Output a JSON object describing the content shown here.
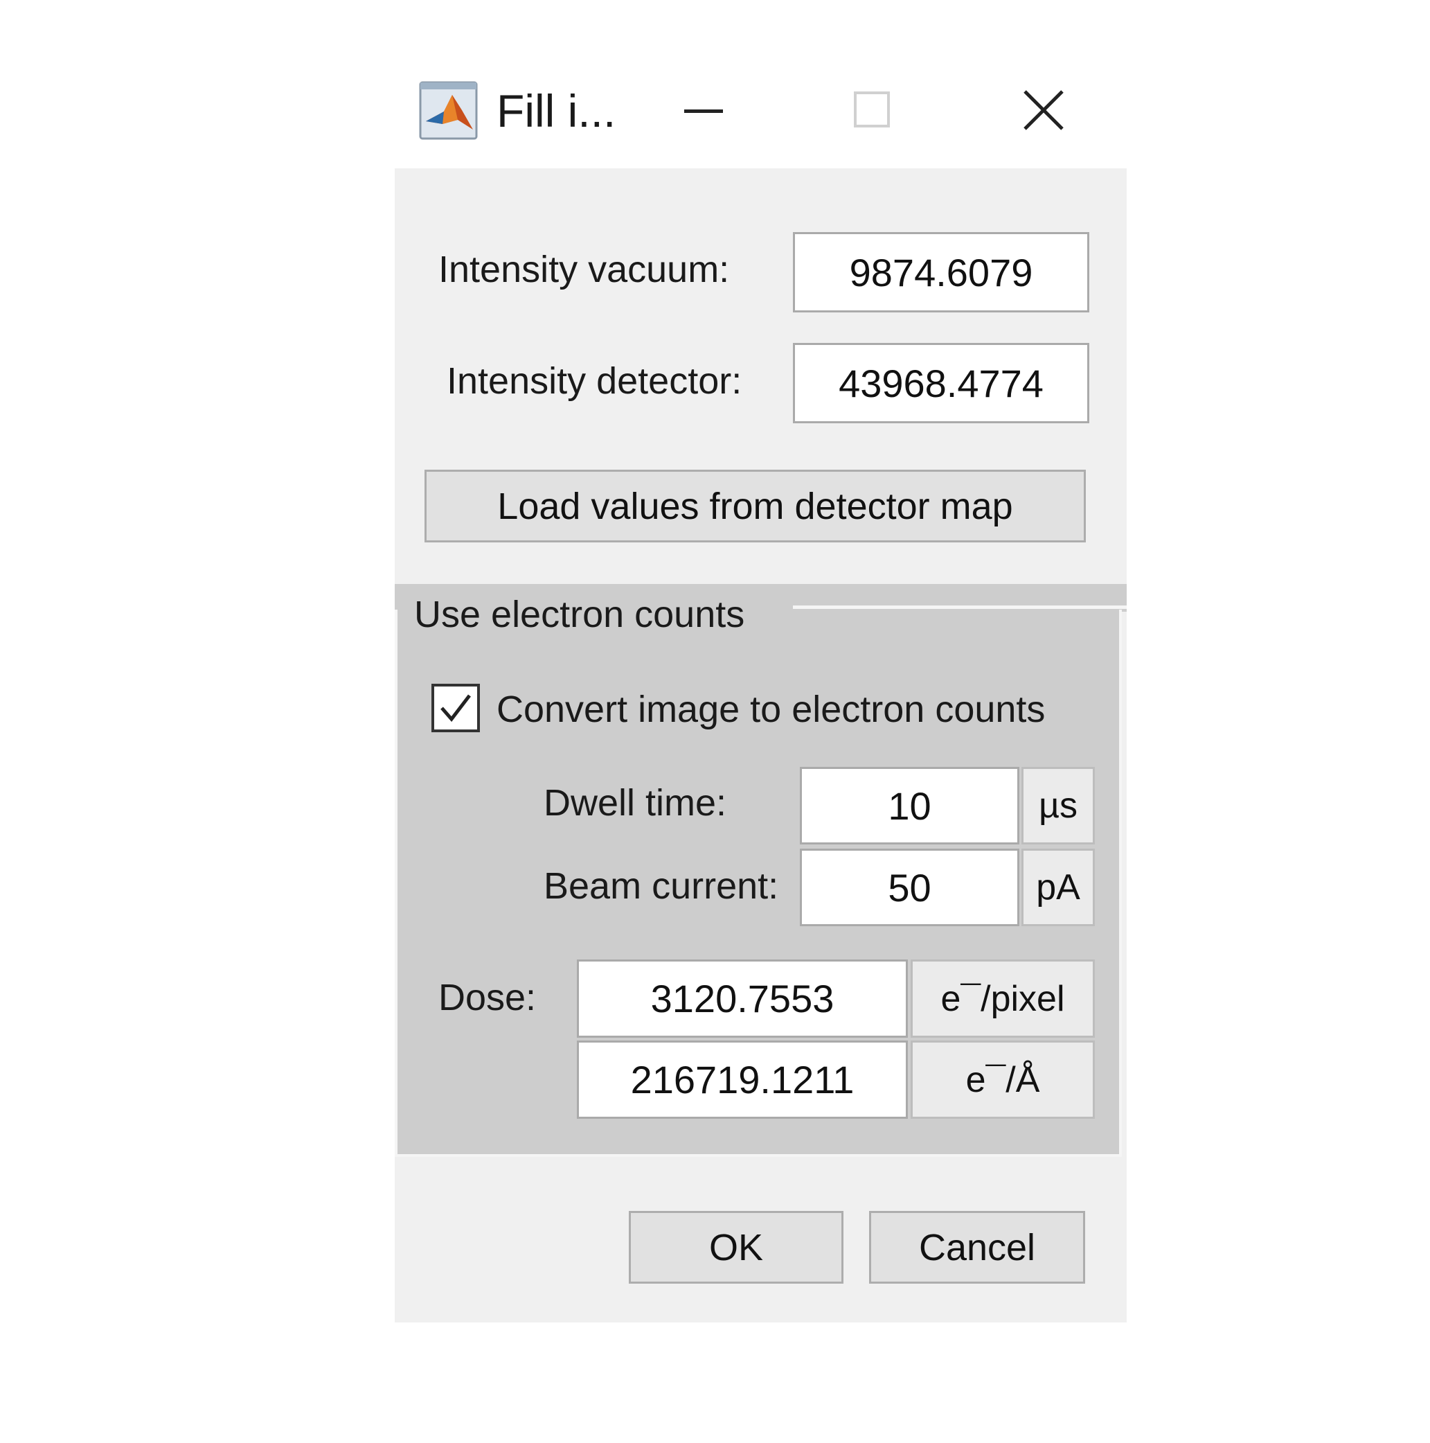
{
  "window": {
    "title": "Fill i..."
  },
  "colors": {
    "panel_bg": "#f0f0f0",
    "group_bg": "#cdcdcd",
    "field_bg": "#ffffff",
    "button_bg": "#e1e1e1"
  },
  "intensity": {
    "vacuum_label": "Intensity vacuum:",
    "vacuum_value": "9874.6079",
    "detector_label": "Intensity detector:",
    "detector_value": "43968.4774",
    "load_button": "Load values from detector map"
  },
  "electron_counts": {
    "group_title": "Use electron counts",
    "convert_label": "Convert image to electron counts",
    "convert_checked": true,
    "dwell_label": "Dwell time:",
    "dwell_value": "10",
    "dwell_unit": "µs",
    "beam_label": "Beam current:",
    "beam_value": "50",
    "beam_unit": "pA",
    "dose_label": "Dose:",
    "dose_pixel_value": "3120.7553",
    "dose_pixel_unit": "e¯/pixel",
    "dose_area_value": "216719.1211",
    "dose_area_unit": "e¯/Å"
  },
  "footer": {
    "ok": "OK",
    "cancel": "Cancel"
  }
}
